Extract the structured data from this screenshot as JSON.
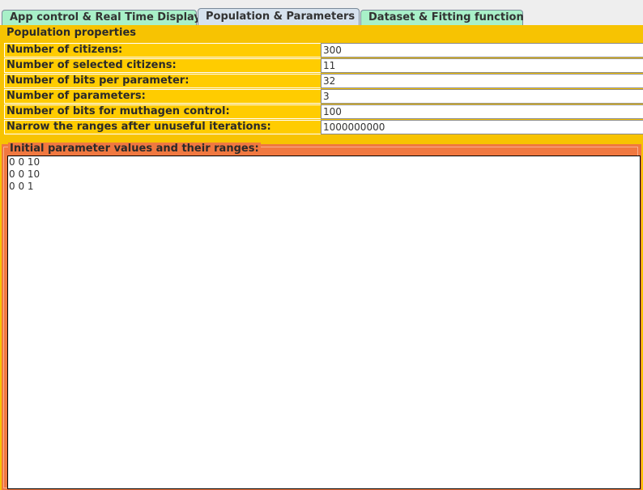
{
  "tabs": [
    {
      "label": "App control & Real Time Display",
      "active": false
    },
    {
      "label": "Population & Parameters",
      "active": true
    },
    {
      "label": "Dataset & Fitting function",
      "active": false
    }
  ],
  "population": {
    "title": "Population properties",
    "rows": [
      {
        "label": "Number of citizens:",
        "value": "300"
      },
      {
        "label": "Number of selected citizens:",
        "value": "11"
      },
      {
        "label": "Number of bits per parameter:",
        "value": "32"
      },
      {
        "label": "Number of parameters:",
        "value": "3"
      },
      {
        "label": "Number of bits for muthagen control:",
        "value": "100"
      },
      {
        "label": "Narrow the ranges after unuseful iterations:",
        "value": "1000000000"
      }
    ]
  },
  "ranges": {
    "title": "Initial parameter values and their ranges:",
    "text": "0 0 10\n0 0 10\n0 0 1"
  },
  "colors": {
    "panel_bg": "#f7c302",
    "label_bg": "#ffcc00",
    "ranges_bg": "#f07840",
    "tab_inactive": "#a8f0c8",
    "tab_active": "#d6e2ee"
  }
}
